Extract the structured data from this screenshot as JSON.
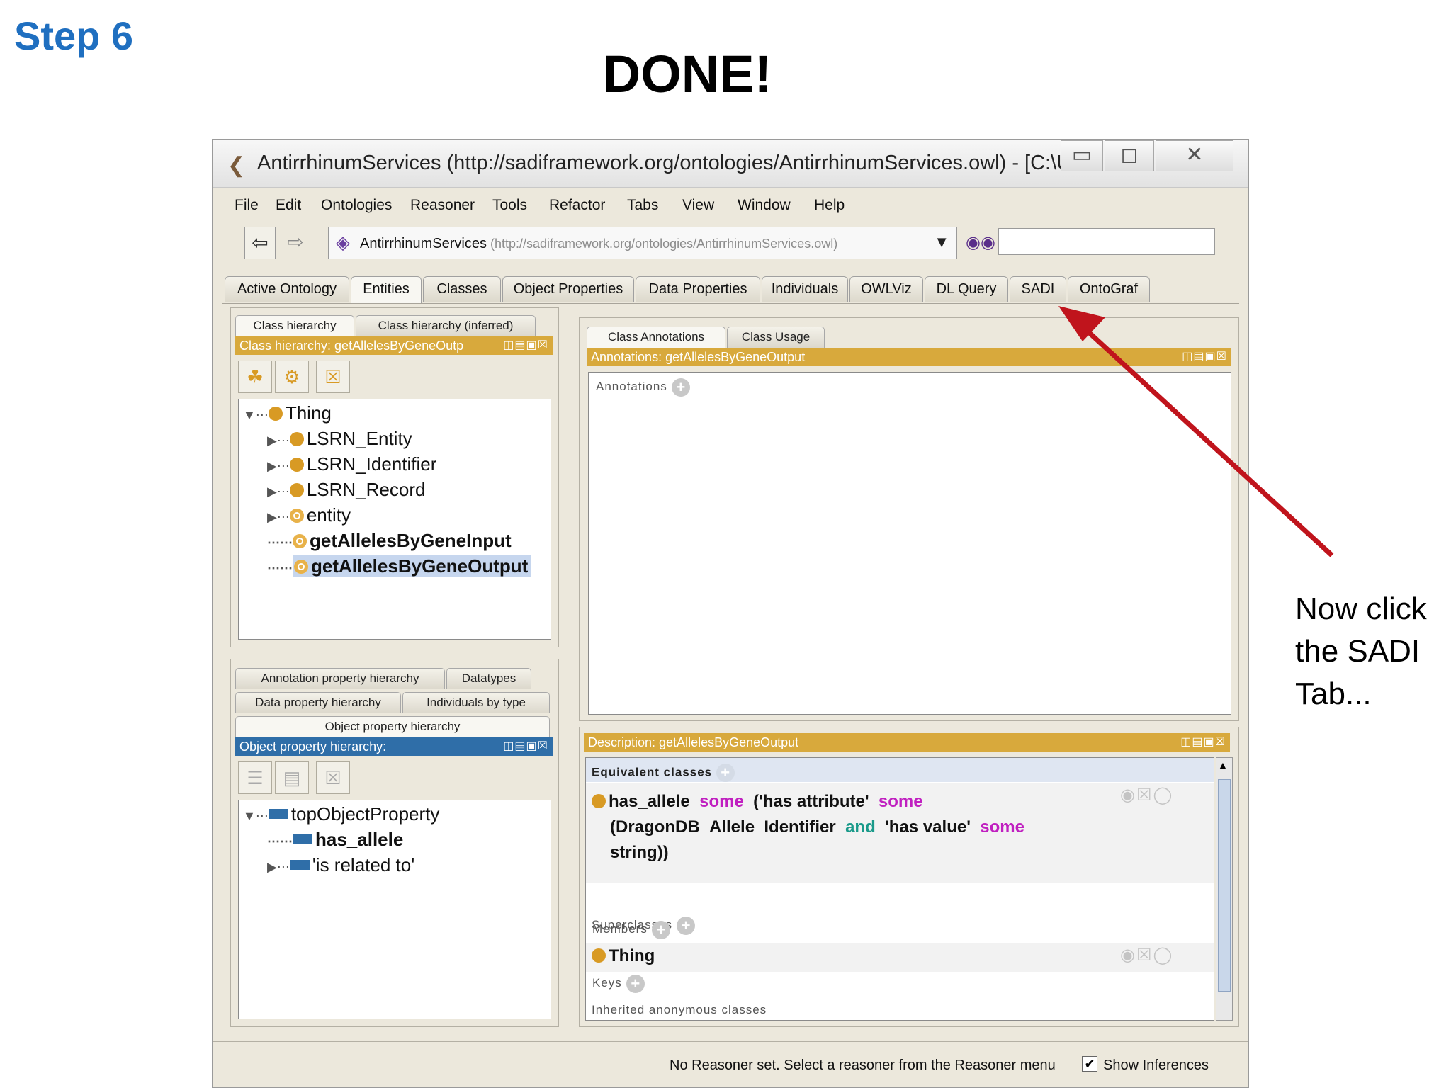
{
  "slide": {
    "step": "Step 6",
    "headline": "DONE!",
    "note": "Now click the SADI Tab..."
  },
  "window": {
    "title": "AntirrhinumServices (http://sadiframework.org/ontologies/AntirrhinumServices.owl) - [C:\\U...",
    "controls": {
      "minimize": "▭",
      "maximize": "◻",
      "close": "✕"
    }
  },
  "menubar": [
    "File",
    "Edit",
    "Ontologies",
    "Reasoner",
    "Tools",
    "Refactor",
    "Tabs",
    "View",
    "Window",
    "Help"
  ],
  "navigation": {
    "back": "⇦",
    "forward": "⇨",
    "ontology_name": "AntirrhinumServices",
    "ontology_uri": "(http://sadiframework.org/ontologies/AntirrhinumServices.owl)",
    "search_placeholder": ""
  },
  "tabs": [
    "Active Ontology",
    "Entities",
    "Classes",
    "Object Properties",
    "Data Properties",
    "Individuals",
    "OWLViz",
    "DL Query",
    "SADI",
    "OntoGraf"
  ],
  "active_tab": "Entities",
  "class_panel": {
    "tabs": [
      "Class hierarchy",
      "Class hierarchy (inferred)"
    ],
    "header": "Class hierarchy: getAllelesByGeneOutp",
    "tree": [
      "Thing",
      "LSRN_Entity",
      "LSRN_Identifier",
      "LSRN_Record",
      "entity",
      "getAllelesByGeneInput",
      "getAllelesByGeneOutput"
    ]
  },
  "property_panel": {
    "tabs_row1": [
      "Annotation property hierarchy",
      "Datatypes"
    ],
    "tabs_row2": [
      "Data property hierarchy",
      "Individuals by type"
    ],
    "tabs_row3": [
      "Object property hierarchy"
    ],
    "header": "Object property hierarchy:",
    "tree": [
      "topObjectProperty",
      "has_allele",
      "'is related to'"
    ]
  },
  "annotations_panel": {
    "tabs": [
      "Class Annotations",
      "Class Usage"
    ],
    "header": "Annotations: getAllelesByGeneOutput",
    "section": "Annotations"
  },
  "description_panel": {
    "header": "Description: getAllelesByGeneOutput",
    "equivalent_label": "Equivalent classes",
    "equivalent_expr": {
      "p1": "has_allele",
      "k1": "some",
      "p2": "('has attribute'",
      "k2": "some",
      "p3": "(DragonDB_Allele_Identifier",
      "k3": "and",
      "p4": "'has value'",
      "k4": "some",
      "p5": "string))"
    },
    "superclasses_label": "Superclasses",
    "superclass": "Thing",
    "inherited_label": "Inherited anonymous classes",
    "members_label": "Members",
    "keys_label": "Keys"
  },
  "status": {
    "message": "No Reasoner set. Select a reasoner from the Reasoner menu",
    "show_inferences": "Show Inferences"
  },
  "colors": {
    "view_header_gold": "#d8a93c",
    "view_header_blue": "#2f6ea8",
    "arrow": "#c0141c",
    "step_blue": "#1f6fc0"
  }
}
